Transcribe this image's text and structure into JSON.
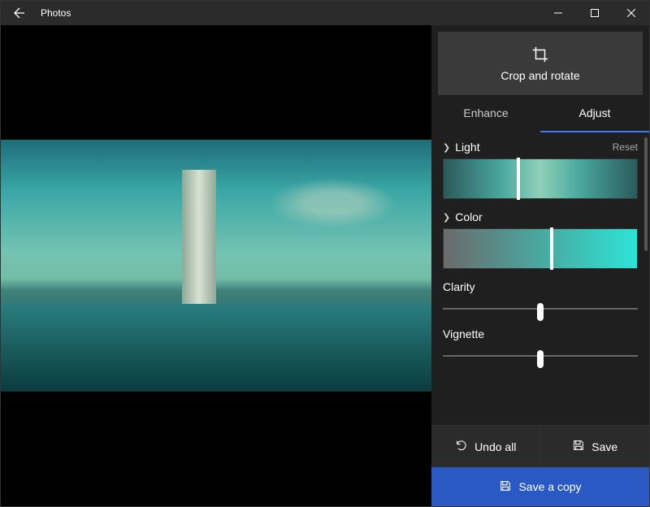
{
  "title": "Photos",
  "crop_label": "Crop and rotate",
  "tabs": {
    "enhance": "Enhance",
    "adjust": "Adjust",
    "active": "adjust"
  },
  "sections": {
    "light": {
      "label": "Light",
      "reset": "Reset",
      "handle_pct": 38
    },
    "color": {
      "label": "Color",
      "handle_pct": 55
    }
  },
  "sliders": {
    "clarity": {
      "label": "Clarity",
      "value_pct": 50
    },
    "vignette": {
      "label": "Vignette",
      "value_pct": 50
    }
  },
  "actions": {
    "undo": "Undo all",
    "save": "Save",
    "savecopy": "Save a copy"
  }
}
